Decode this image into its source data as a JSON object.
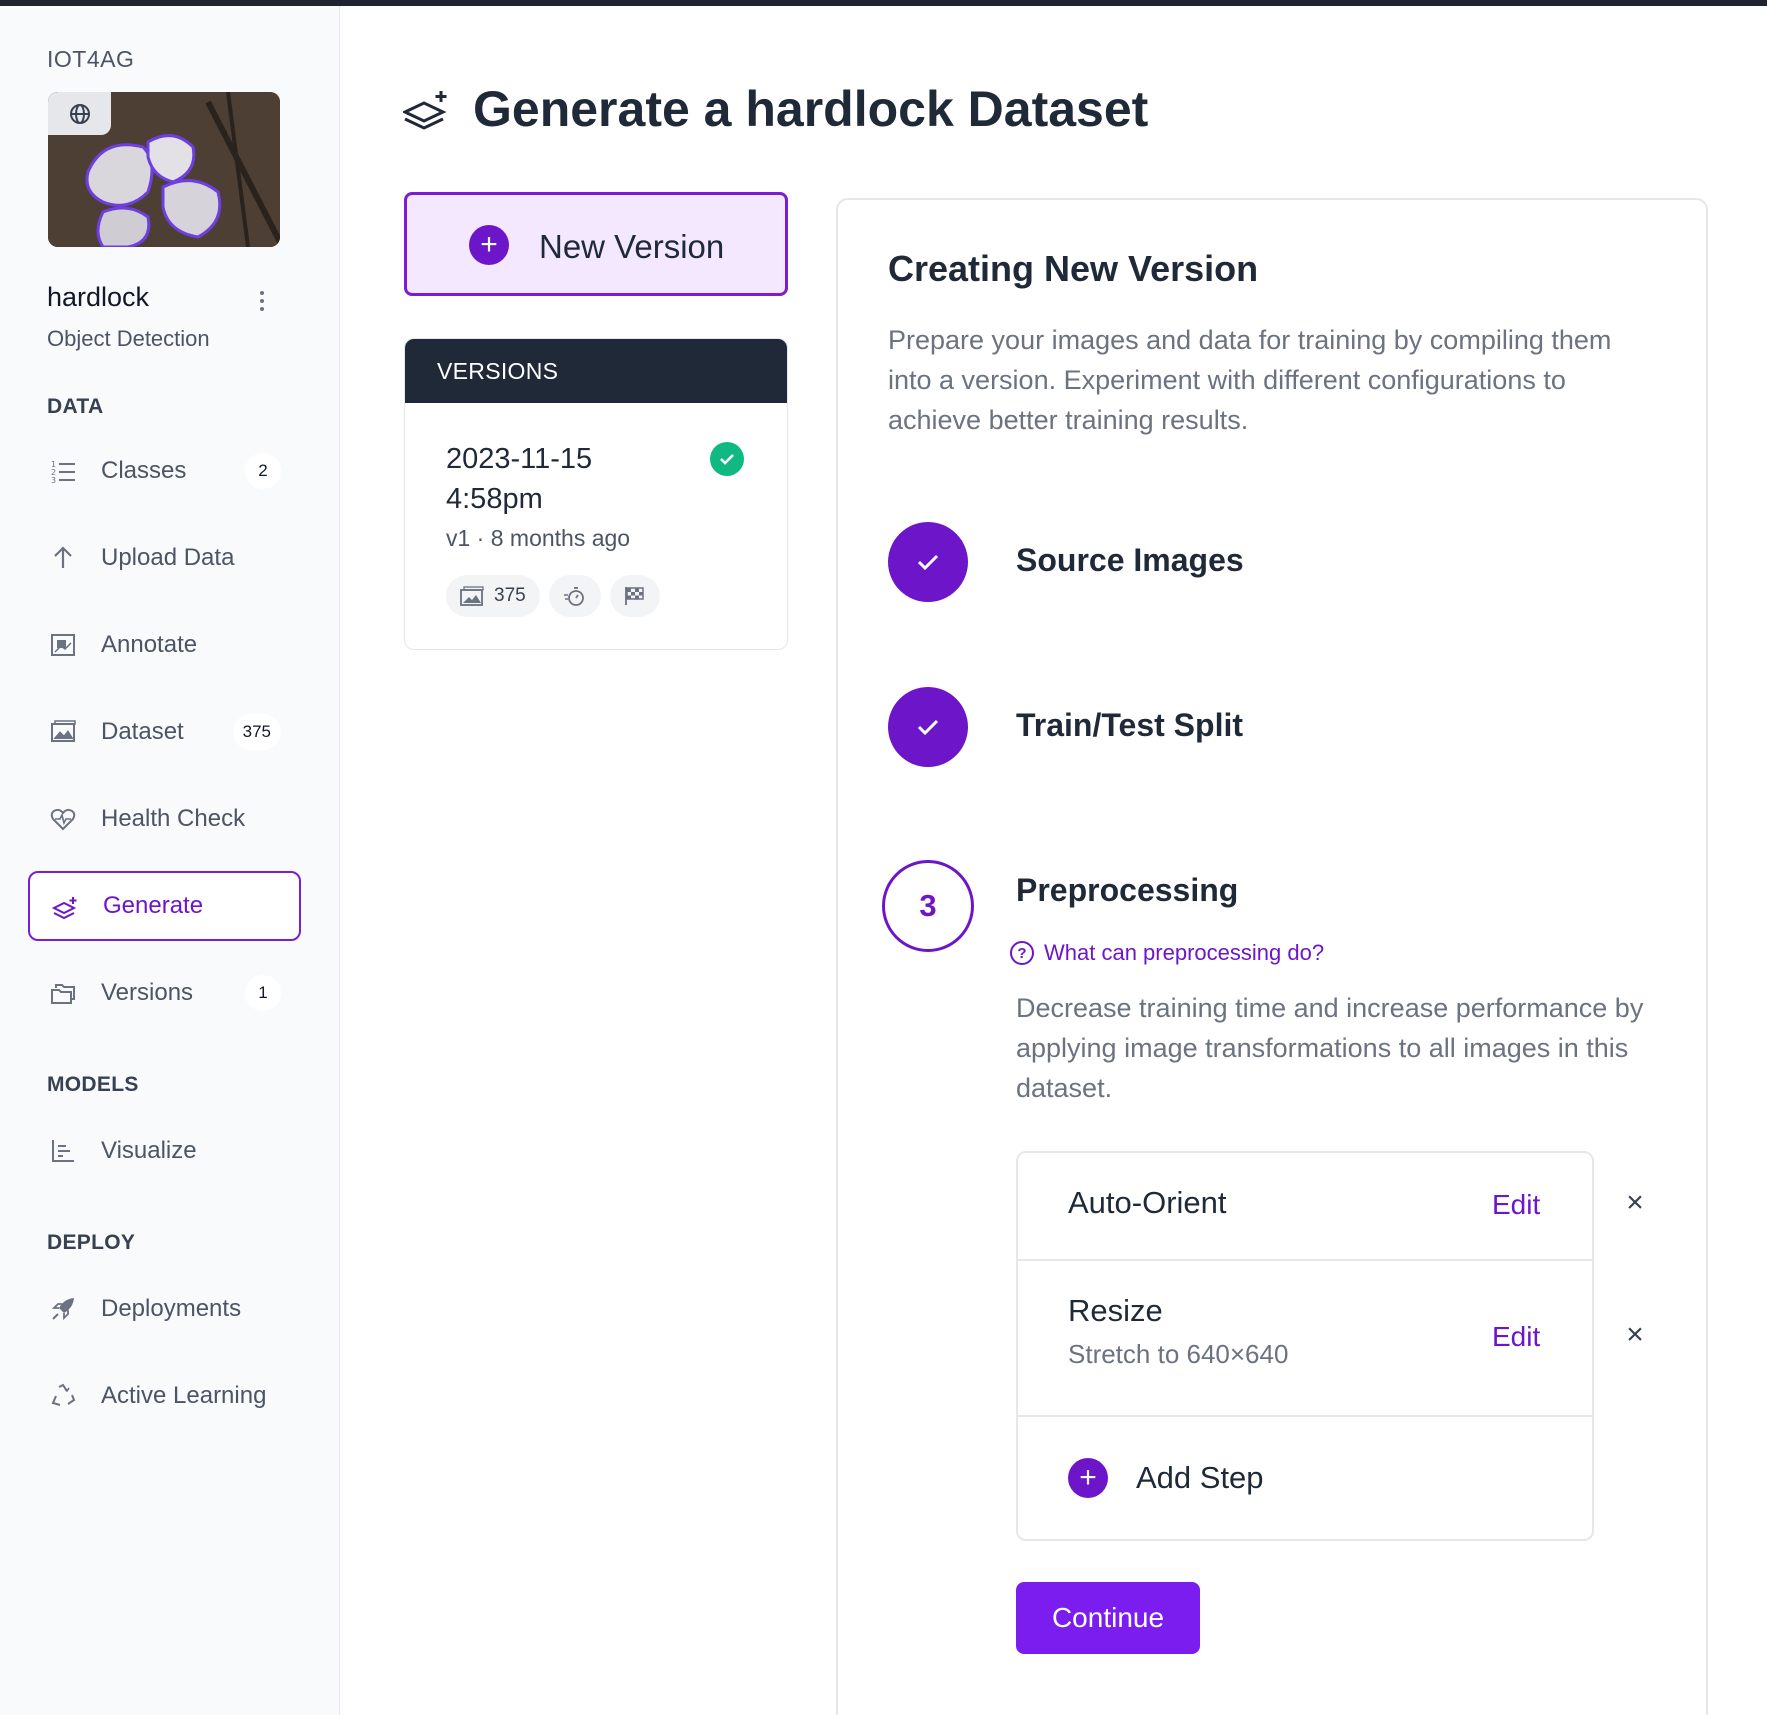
{
  "workspace": {
    "name": "IOT4AG"
  },
  "project": {
    "name": "hardlock",
    "type": "Object Detection"
  },
  "sidebar": {
    "sections": {
      "data": "DATA",
      "models": "MODELS",
      "deploy": "DEPLOY"
    },
    "items": [
      {
        "label": "Classes",
        "count": "2",
        "icon": "list-numbered-icon"
      },
      {
        "label": "Upload Data",
        "icon": "arrow-up-icon"
      },
      {
        "label": "Annotate",
        "icon": "annotate-icon"
      },
      {
        "label": "Dataset",
        "count": "375",
        "icon": "images-icon"
      },
      {
        "label": "Health Check",
        "icon": "heart-pulse-icon"
      },
      {
        "label": "Generate",
        "icon": "layers-plus-icon",
        "active": true
      },
      {
        "label": "Versions",
        "count": "1",
        "icon": "folders-icon"
      },
      {
        "label": "Visualize",
        "icon": "bar-chart-icon"
      },
      {
        "label": "Deployments",
        "icon": "rocket-icon"
      },
      {
        "label": "Active Learning",
        "icon": "recycle-icon"
      }
    ]
  },
  "page": {
    "title": "Generate a hardlock Dataset",
    "new_version_label": "New Version"
  },
  "versions": {
    "header": "VERSIONS",
    "list": [
      {
        "date": "2023-11-15 4:58pm",
        "meta": "v1 · 8 months ago",
        "images": "375",
        "status": "complete"
      }
    ]
  },
  "panel": {
    "title": "Creating New Version",
    "description": "Prepare your images and data for training by compiling them into a version. Experiment with different configurations to achieve better training results.",
    "steps": [
      {
        "label": "Source Images",
        "state": "done"
      },
      {
        "label": "Train/Test Split",
        "state": "done"
      },
      {
        "label": "Preprocessing",
        "state": "current",
        "number": "3"
      }
    ],
    "preprocessing": {
      "help_link": "What can preprocessing do?",
      "description": "Decrease training time and increase performance by applying image transformations to all images in this dataset.",
      "items": [
        {
          "name": "Auto-Orient",
          "edit": "Edit"
        },
        {
          "name": "Resize",
          "detail": "Stretch to 640×640",
          "edit": "Edit"
        }
      ],
      "add_step": "Add Step"
    },
    "continue_label": "Continue"
  },
  "colors": {
    "accent": "#6d16c9",
    "button": "#7c1df0",
    "success": "#10b981",
    "dark_header": "#1f2937"
  }
}
